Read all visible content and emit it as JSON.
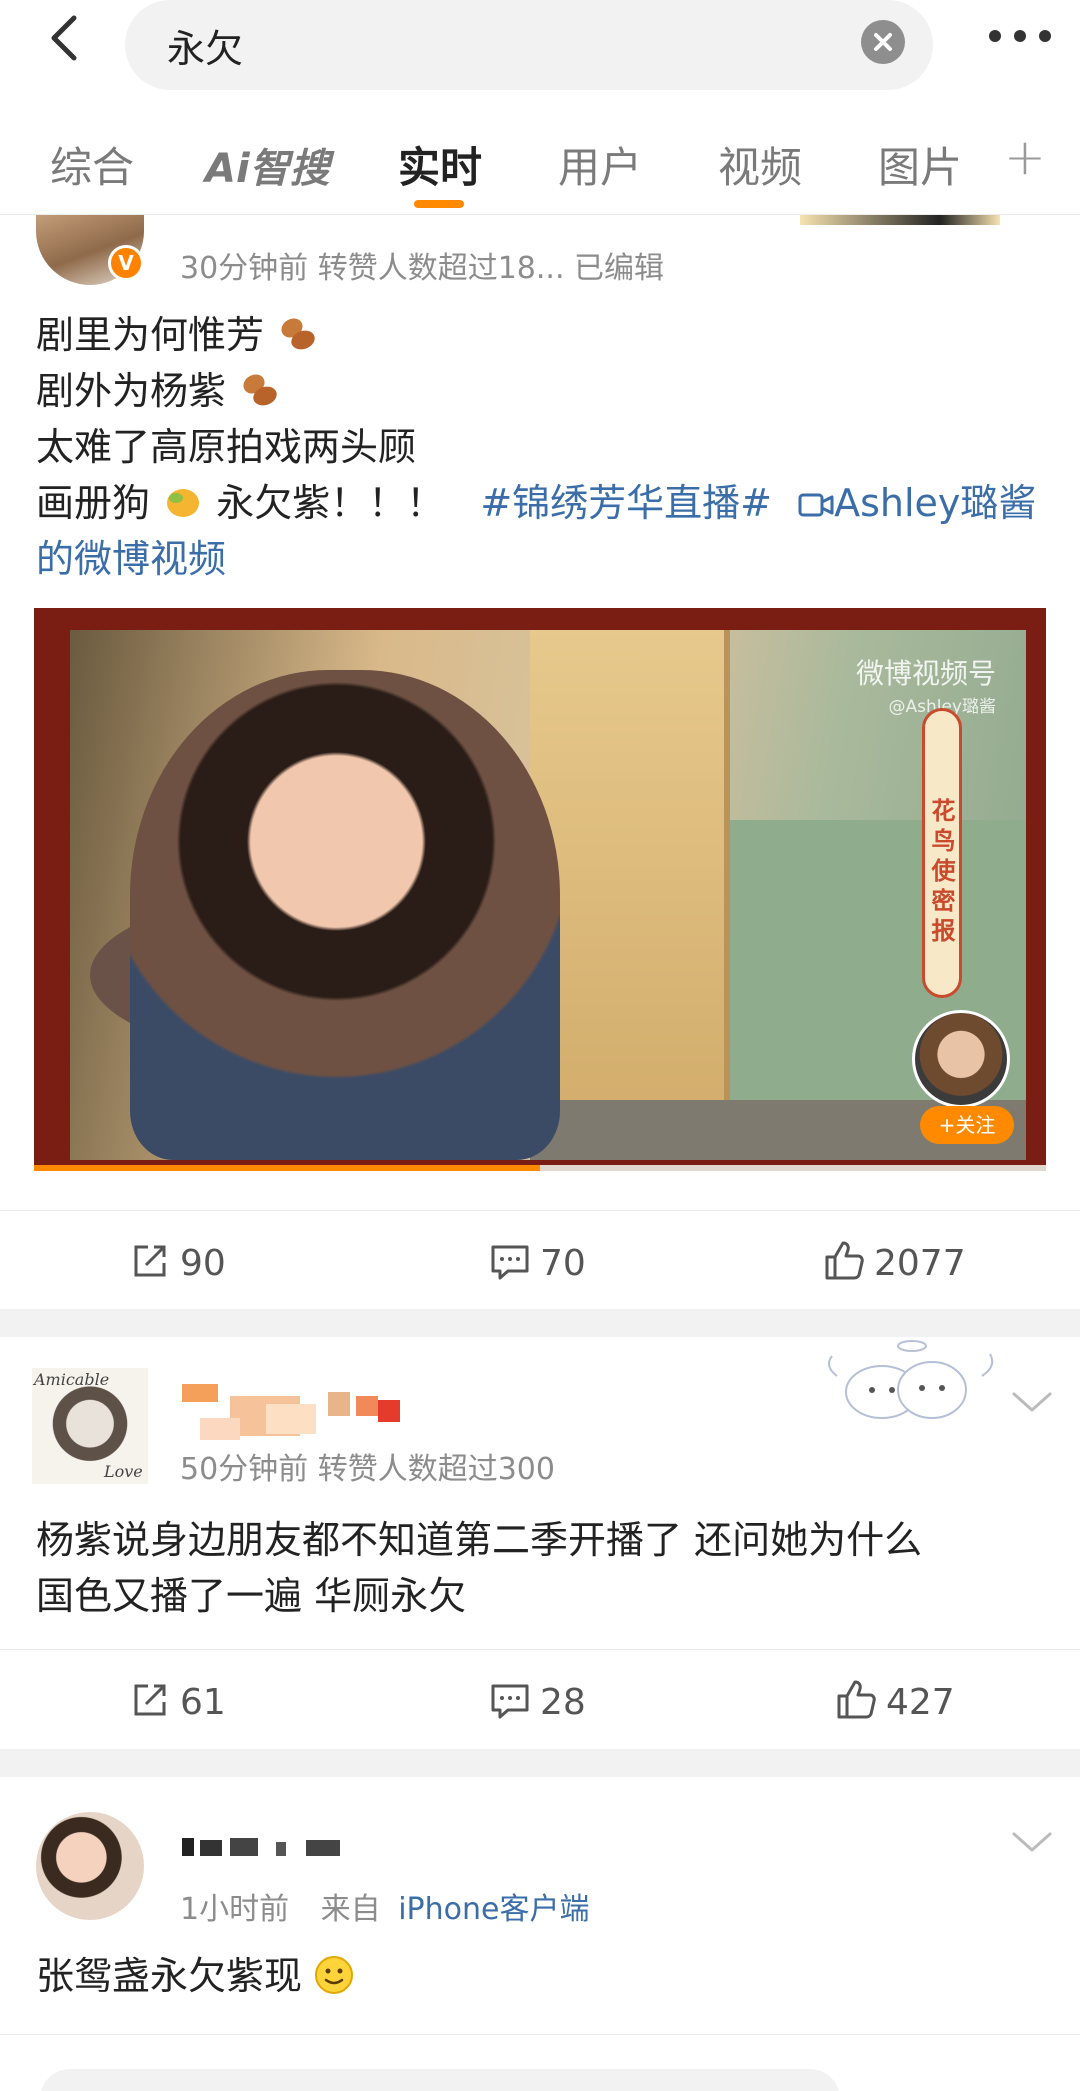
{
  "header": {
    "search_query": "永欠",
    "tabs": [
      {
        "label": "综合",
        "active": false
      },
      {
        "label": "智搜",
        "prefix": "Ai",
        "active": false
      },
      {
        "label": "实时",
        "active": true
      },
      {
        "label": "用户",
        "active": false
      },
      {
        "label": "视频",
        "active": false
      },
      {
        "label": "图片",
        "active": false
      }
    ],
    "tab_plus": "+",
    "accent_color": "#ff8a00"
  },
  "posts": [
    {
      "meta": "30分钟前  转赞人数超过18...  已编辑",
      "verified_badge": "V",
      "lines": [
        "剧里为何惟芳",
        "剧外为杨紫",
        "太难了高原拍戏两头顾",
        "画册狗",
        "永欠紫！！！",
        "#锦绣芳华直播#",
        "Ashley璐酱",
        "的微博视频"
      ],
      "video": {
        "watermark": "微博视频号",
        "watermark_user": "@Ashley璐酱",
        "banner": "花鸟使密报",
        "follow_label": "+关注"
      },
      "actions": {
        "repost": "90",
        "comment": "70",
        "like": "2077"
      }
    },
    {
      "meta": "50分钟前  转赞人数超过300",
      "avatar_text_top": "Amicable",
      "avatar_text_bottom": "Love",
      "text_line1": "杨紫说身边朋友都不知道第二季开播了 还问她为什么",
      "text_line2": "国色又播了一遍 华厕永欠",
      "actions": {
        "repost": "61",
        "comment": "28",
        "like": "427"
      }
    },
    {
      "meta_time": "1小时前",
      "meta_from": "来自",
      "meta_source": "iPhone客户端",
      "text": "张鸳盏永欠紫现"
    }
  ],
  "icons": {
    "back": "chevron-left-icon",
    "clear": "close-circle-icon",
    "more": "ellipsis-icon",
    "repost": "share-icon",
    "comment": "comment-icon",
    "like": "thumbs-up-icon"
  }
}
